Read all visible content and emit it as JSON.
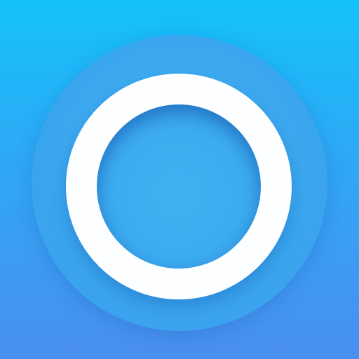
{
  "icon": {
    "name": "circle-ring-app-icon",
    "colors": {
      "background_top": "#14c2fb",
      "background_bottom": "#4a8ff0",
      "halo": "#3aa6ef",
      "ring": "#fdfeff"
    }
  }
}
